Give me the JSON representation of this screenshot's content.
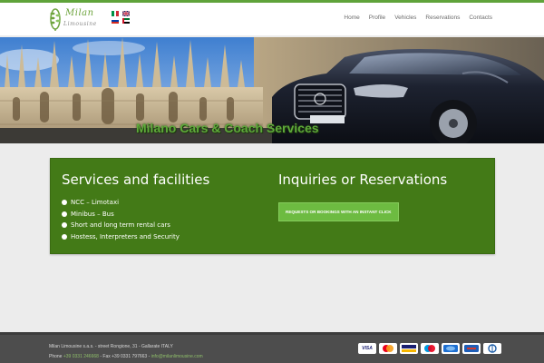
{
  "header": {
    "logo": {
      "word1": "Milan",
      "word2": "Limousine"
    },
    "languages": [
      "IT",
      "EN",
      "RU",
      "AE"
    ],
    "nav": [
      "Home",
      "Profile",
      "Vehicles",
      "Reservations",
      "Contacts"
    ]
  },
  "hero": {
    "title": "Milano Cars & Coach Services",
    "plate_text": "Milano"
  },
  "panel": {
    "left_title": "Services and facilities",
    "services": [
      "NCC – Limotaxi",
      "Minibus – Bus",
      "Short and long term rental cars",
      "Hostess, Interpreters and Security"
    ],
    "right_title": "Inquiries or Reservations",
    "cta_label": "REQUESTS OR BOOKINGS WITH AN INSTANT CLICK"
  },
  "footer": {
    "company_line": "Milan Limousine s.a.s. - street Rongione, 31 - Gallarate ITALY",
    "phone_label": "Phone",
    "phone": "+39 0331 246668",
    "fax_label": "Fax",
    "fax": "+39 0331 797663",
    "email": "info@milanlimousine.com",
    "cards": [
      "VISA",
      "Mastercard",
      "Visa Electron",
      "Maestro",
      "Postepay",
      "American Express",
      "Diners Club"
    ]
  },
  "colors": {
    "brand_green": "#437a17",
    "accent_green": "#6dbb41",
    "footer_gray": "#4d4d4d"
  }
}
